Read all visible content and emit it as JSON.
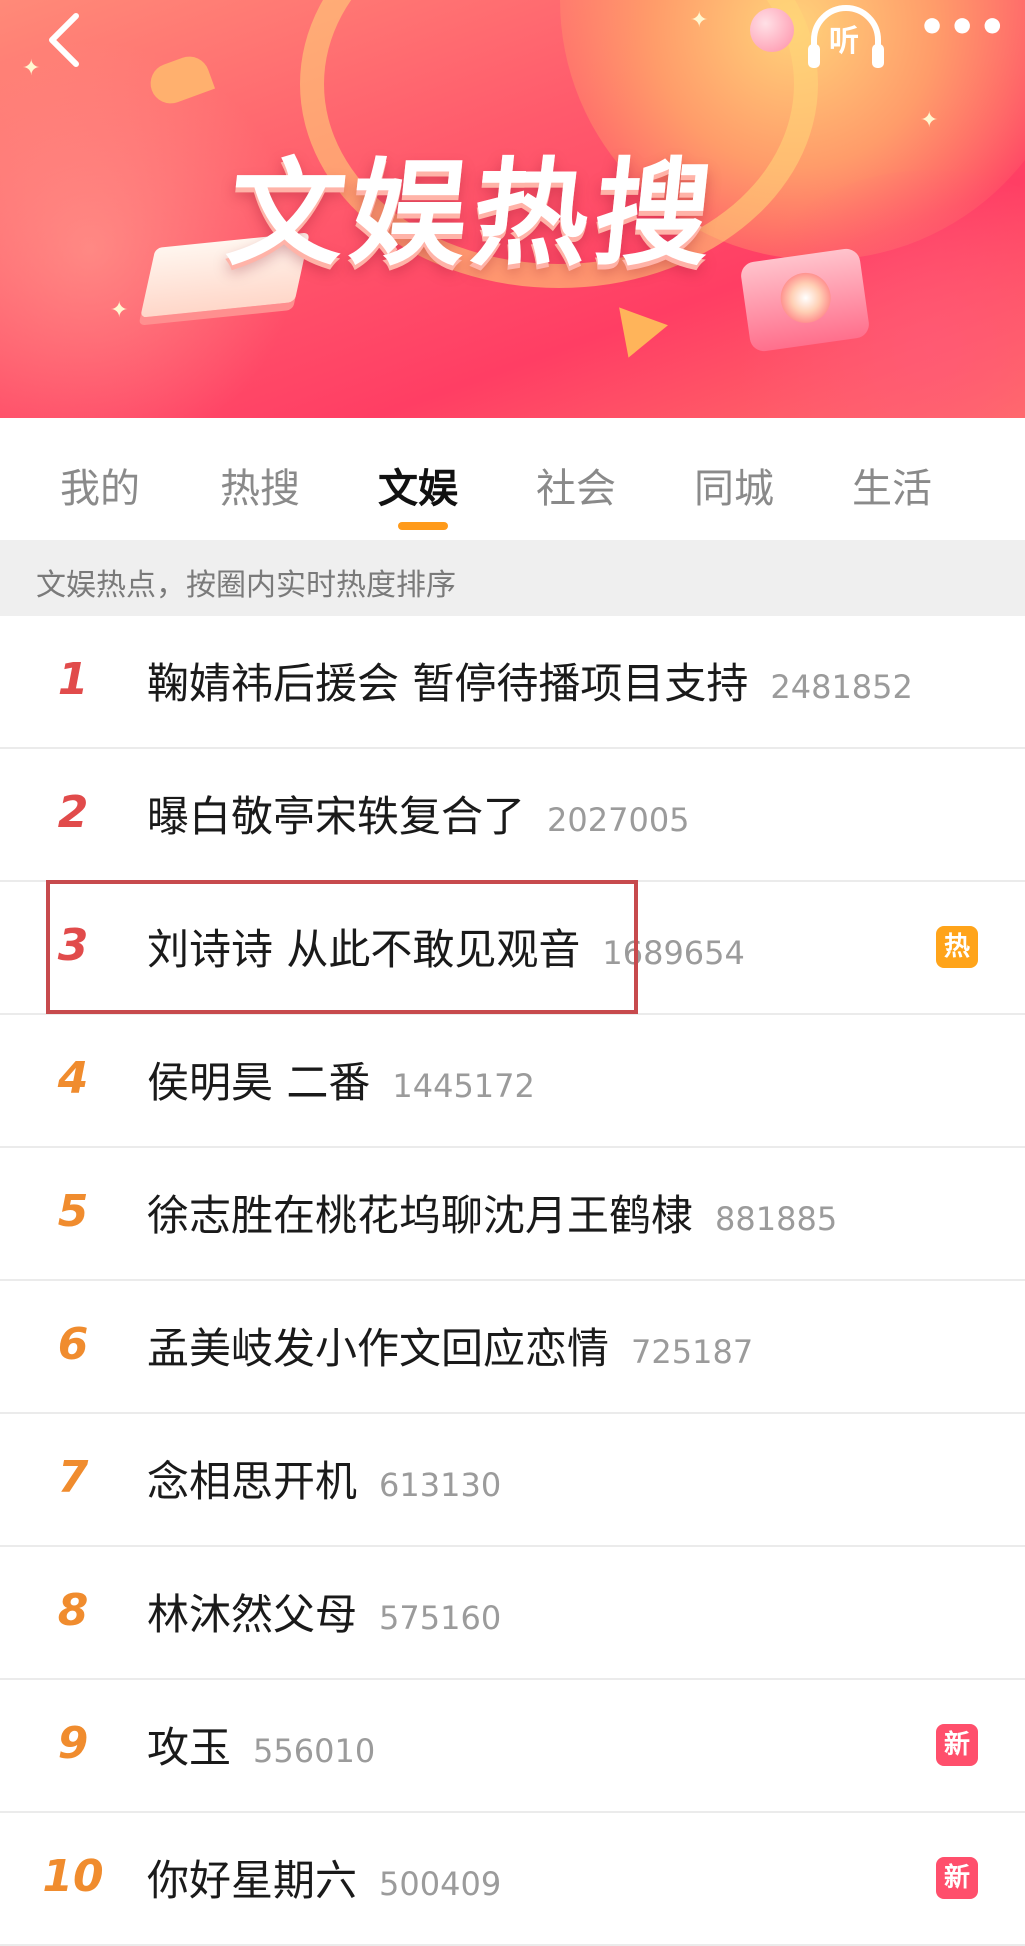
{
  "banner": {
    "title": "文娱热搜",
    "listen_label": "听",
    "more_label": "•••"
  },
  "tabs": [
    {
      "label": "我的",
      "active": false
    },
    {
      "label": "热搜",
      "active": false
    },
    {
      "label": "文娱",
      "active": true
    },
    {
      "label": "社会",
      "active": false
    },
    {
      "label": "同城",
      "active": false
    },
    {
      "label": "生活",
      "active": false
    }
  ],
  "info_text": "文娱热点，按圈内实时热度排序",
  "items": [
    {
      "rank": "1",
      "title": "鞠婧祎后援会 暂停待播项目支持",
      "count": "2481852",
      "badge": ""
    },
    {
      "rank": "2",
      "title": "曝白敬亭宋轶复合了",
      "count": "2027005",
      "badge": ""
    },
    {
      "rank": "3",
      "title": "刘诗诗 从此不敢见观音",
      "count": "1689654",
      "badge": "热"
    },
    {
      "rank": "4",
      "title": "侯明昊 二番",
      "count": "1445172",
      "badge": ""
    },
    {
      "rank": "5",
      "title": "徐志胜在桃花坞聊沈月王鹤棣",
      "count": "881885",
      "badge": ""
    },
    {
      "rank": "6",
      "title": "孟美岐发小作文回应恋情",
      "count": "725187",
      "badge": ""
    },
    {
      "rank": "7",
      "title": "念相思开机",
      "count": "613130",
      "badge": ""
    },
    {
      "rank": "8",
      "title": "林沐然父母",
      "count": "575160",
      "badge": ""
    },
    {
      "rank": "9",
      "title": "攻玉",
      "count": "556010",
      "badge": "新"
    },
    {
      "rank": "10",
      "title": "你好星期六",
      "count": "500409",
      "badge": "新"
    }
  ],
  "colors": {
    "rank_top": "#e14b4b",
    "rank_rest": "#f08c2e",
    "badge_hot": "#ffa41a",
    "badge_new": "#ff4f6c",
    "tab_indicator": "#ff9a1a",
    "highlight_box": "#c74a4d"
  }
}
